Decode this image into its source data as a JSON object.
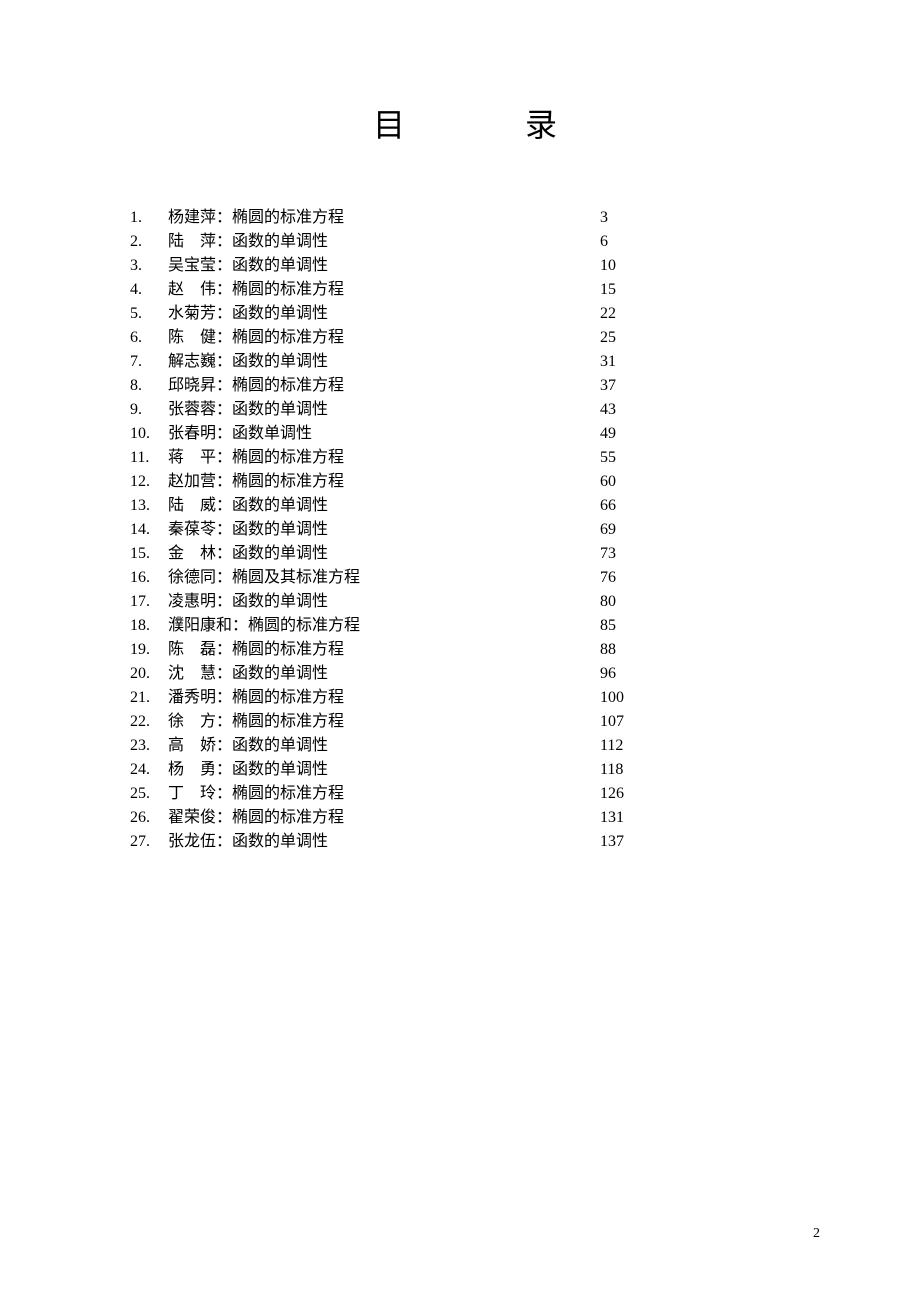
{
  "title": "目录",
  "page_number": "2",
  "entries": [
    {
      "num": "1.",
      "author": "杨建萍：",
      "topic": "椭圆的标准方程",
      "page": "3"
    },
    {
      "num": "2.",
      "author": "陆　萍：",
      "topic": "函数的单调性",
      "page": "6"
    },
    {
      "num": "3.",
      "author": "吴宝莹：",
      "topic": "函数的单调性",
      "page": "10"
    },
    {
      "num": "4.",
      "author": "赵　伟：",
      "topic": "椭圆的标准方程",
      "page": "15"
    },
    {
      "num": "5.",
      "author": "水菊芳：",
      "topic": "函数的单调性",
      "page": "22"
    },
    {
      "num": "6.",
      "author": "陈　健：",
      "topic": "椭圆的标准方程",
      "page": "25"
    },
    {
      "num": "7.",
      "author": "解志巍：",
      "topic": "函数的单调性",
      "page": "31"
    },
    {
      "num": "8.",
      "author": "邱晓昇：",
      "topic": "椭圆的标准方程",
      "page": "37"
    },
    {
      "num": "9.",
      "author": "张蓉蓉：",
      "topic": "函数的单调性",
      "page": "43"
    },
    {
      "num": "10.",
      "author": "张春明：",
      "topic": "函数单调性",
      "page": "49"
    },
    {
      "num": "11.",
      "author": "蒋　平：",
      "topic": "椭圆的标准方程",
      "page": "55"
    },
    {
      "num": "12.",
      "author": "赵加营：",
      "topic": "椭圆的标准方程",
      "page": "60"
    },
    {
      "num": "13.",
      "author": "陆　威：",
      "topic": "函数的单调性",
      "page": "66"
    },
    {
      "num": "14.",
      "author": "秦葆苓：",
      "topic": "函数的单调性",
      "page": "69"
    },
    {
      "num": "15.",
      "author": "金　林：",
      "topic": "函数的单调性",
      "page": "73"
    },
    {
      "num": "16.",
      "author": "徐德同：",
      "topic": "椭圆及其标准方程",
      "page": "76"
    },
    {
      "num": "17.",
      "author": "凌惠明：",
      "topic": "函数的单调性",
      "page": "80"
    },
    {
      "num": "18.",
      "author": "濮阳康和：",
      "topic": "椭圆的标准方程",
      "page": "85"
    },
    {
      "num": "19.",
      "author": "陈　磊：",
      "topic": "椭圆的标准方程",
      "page": "88"
    },
    {
      "num": "20.",
      "author": "沈　慧：",
      "topic": "函数的单调性",
      "page": "96"
    },
    {
      "num": "21.",
      "author": "潘秀明：",
      "topic": "椭圆的标准方程",
      "page": "100"
    },
    {
      "num": "22.",
      "author": "徐　方：",
      "topic": "椭圆的标准方程",
      "page": "107"
    },
    {
      "num": "23.",
      "author": "高　娇：",
      "topic": "函数的单调性",
      "page": "112"
    },
    {
      "num": "24.",
      "author": "杨　勇：",
      "topic": "函数的单调性",
      "page": "118"
    },
    {
      "num": "25.",
      "author": "丁　玲：",
      "topic": "椭圆的标准方程",
      "page": "126"
    },
    {
      "num": "26.",
      "author": "翟荣俊：",
      "topic": "椭圆的标准方程",
      "page": "131"
    },
    {
      "num": "27.",
      "author": "张龙伍：",
      "topic": "函数的单调性",
      "page": "137"
    }
  ]
}
